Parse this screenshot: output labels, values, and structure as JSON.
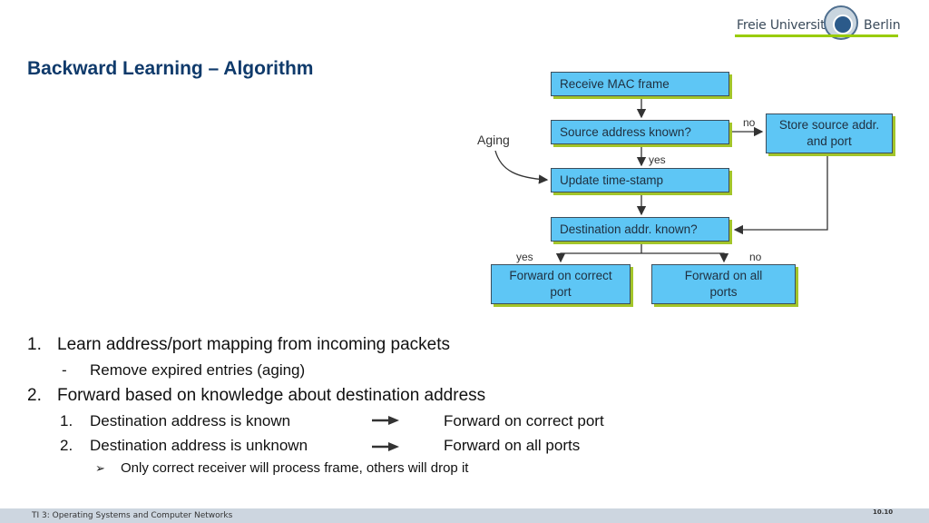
{
  "header": {
    "logo_left": "Freie Universität",
    "logo_right": "Berlin",
    "title": "Backward Learning – Algorithm",
    "accent_color": "#99cc00",
    "title_color": "#0f3a6b"
  },
  "diagram": {
    "box_fill": "#5ec6f5",
    "box_shadow": "#a3c52a",
    "nodes": {
      "receive": "Receive MAC frame",
      "source_known": "Source address known?",
      "store_line1": "Store source addr.",
      "store_line2": "and port",
      "update": "Update time-stamp",
      "dest_known": "Destination addr. known?",
      "fwd_correct_line1": "Forward on correct",
      "fwd_correct_line2": "port",
      "fwd_all_line1": "Forward on all",
      "fwd_all_line2": "ports"
    },
    "labels": {
      "no_source": "no",
      "yes_source": "yes",
      "aging": "Aging",
      "yes_dest": "yes",
      "no_dest": "no"
    }
  },
  "content": {
    "item1": {
      "num": "1.",
      "text": "Learn address/port mapping from incoming packets"
    },
    "item1_sub": {
      "bullet": "-",
      "text": "Remove expired entries (aging)"
    },
    "item2": {
      "num": "2.",
      "text": "Forward based on knowledge about destination address"
    },
    "item2_sub1": {
      "num": "1.",
      "text": "Destination address is known",
      "result": "Forward on correct port"
    },
    "item2_sub2": {
      "num": "2.",
      "text": "Destination address is unknown",
      "result": "Forward on all ports"
    },
    "item2_note": {
      "bullet": "➢",
      "text": "Only correct receiver will process frame, others will drop it"
    }
  },
  "footer": {
    "course": "TI 3: Operating Systems and Computer Networks",
    "page": "10.10"
  }
}
